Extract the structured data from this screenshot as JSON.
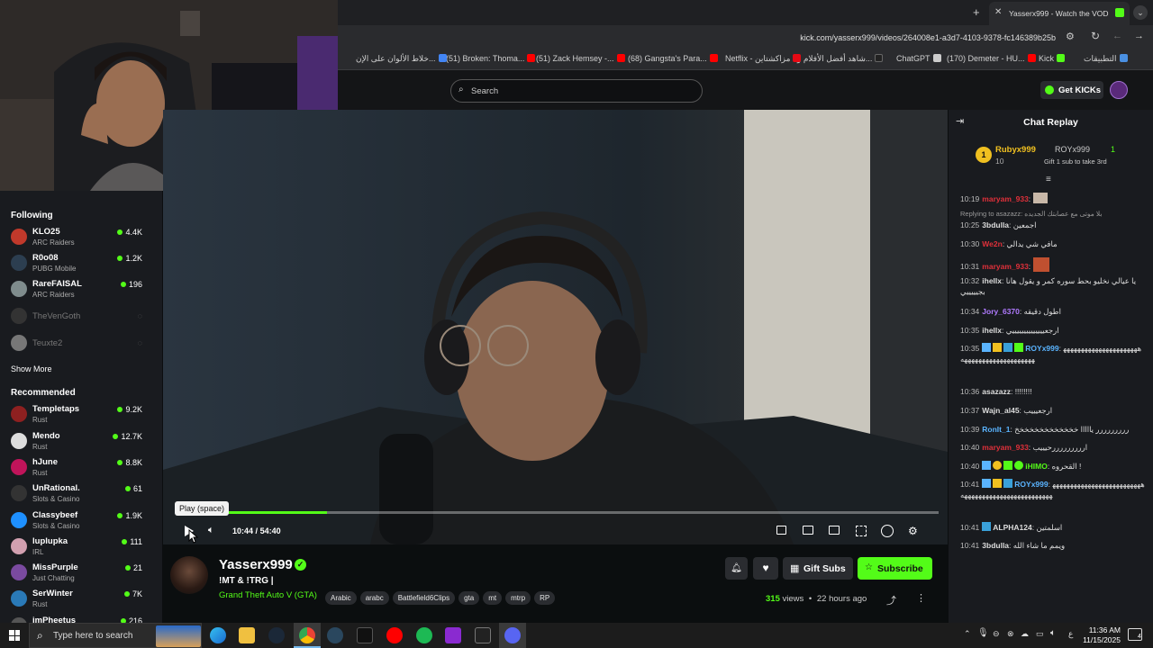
{
  "browser": {
    "active_tab_title": "Yasserx999 - Watch the VOD o",
    "url": "kick.com/yasserx999/videos/264008e1-a3d7-4103-9378-fc146389b25b",
    "bookmarks": [
      {
        "label": "التطبيقات",
        "color": "#4a90e2"
      },
      {
        "label": "Kick",
        "color": "#53fc18"
      },
      {
        "label": "(170) Demeter - HU...",
        "color": "#ff0000"
      },
      {
        "label": "ChatGPT",
        "color": "#ffffff"
      },
      {
        "label": "شاهد أفضل الأفلام و...",
        "color": "#222222"
      },
      {
        "label": "Netflix - مزاكشتاين",
        "color": "#e50914"
      },
      {
        "label": "(68) Gangsta's Para...",
        "color": "#ff0000"
      },
      {
        "label": "(51) Zack Hemsey -...",
        "color": "#ff0000"
      },
      {
        "label": "(51) Broken: Thoma...",
        "color": "#ff0000"
      },
      {
        "label": "خلاط الألوان على الإن...",
        "color": "#4285f4"
      }
    ]
  },
  "header": {
    "search_placeholder": "Search",
    "get_kicks_label": "Get KICKs",
    "brand_color": "#53fc18"
  },
  "sidebar": {
    "following_title": "Following",
    "following": [
      {
        "name": "KLO25",
        "category": "ARC Raiders",
        "viewers": "4.4K",
        "color": "#c0392b"
      },
      {
        "name": "R0o08",
        "category": "PUBG Mobile",
        "viewers": "1.2K",
        "color": "#2c3e50"
      },
      {
        "name": "RareFAISAL",
        "category": "ARC Raiders",
        "viewers": "196",
        "color": "#7f8c8d"
      },
      {
        "name": "TheVenGoth",
        "category": "",
        "viewers": "",
        "color": "#333333"
      },
      {
        "name": "Teuxte2",
        "category": "",
        "viewers": "",
        "color": "#666666"
      }
    ],
    "show_more_label": "Show More",
    "recommended_title": "Recommended",
    "recommended": [
      {
        "name": "Templetaps",
        "category": "Rust",
        "viewers": "9.2K",
        "color": "#8e2020"
      },
      {
        "name": "Mendo",
        "category": "Rust",
        "viewers": "12.7K",
        "color": "#dddddd"
      },
      {
        "name": "hJune",
        "category": "Rust",
        "viewers": "8.8K",
        "color": "#c0145a"
      },
      {
        "name": "UnRational.",
        "category": "Slots & Casino",
        "viewers": "61",
        "color": "#333333"
      },
      {
        "name": "Classybeef",
        "category": "Slots & Casino",
        "viewers": "1.9K",
        "color": "#1e90ff"
      },
      {
        "name": "luplupka",
        "category": "IRL",
        "viewers": "111",
        "color": "#d2a0b0"
      },
      {
        "name": "MissPurple",
        "category": "Just Chatting",
        "viewers": "21",
        "color": "#7a4aa0"
      },
      {
        "name": "SerWinter",
        "category": "Rust",
        "viewers": "7K",
        "color": "#2a7ab8"
      },
      {
        "name": "imPheetus",
        "category": "",
        "viewers": "216",
        "color": "#555555"
      }
    ]
  },
  "player": {
    "tooltip": "Play (space)",
    "time_current": "10:44",
    "time_separator": "/",
    "time_total": "54:40",
    "progress_fraction": 0.196
  },
  "stream": {
    "channel": "Yasserx999",
    "title": "!MT & !TRG |",
    "category": "Grand Theft Auto V (GTA)",
    "tags": [
      "Arabic",
      "arabc",
      "Battlefield6Clips",
      "gta",
      "mt",
      "mtrp",
      "RP"
    ],
    "views_count": "315",
    "views_label": "views",
    "dot": "•",
    "age": "22 hours ago",
    "gift_subs_label": "Gift Subs",
    "subscribe_label": "Subscribe"
  },
  "chat": {
    "title": "Chat Replay",
    "leaderboard": {
      "rank": "1",
      "user": "Rubyx999",
      "count": "10",
      "second_user": "ROYx999",
      "second_count": "1",
      "gift_hint": "Gift 1 sub to take 3rd"
    },
    "messages": [
      {
        "time": "10:19",
        "user": "maryam_933",
        "color": "#e0303a",
        "text": ""
      },
      {
        "time": "",
        "user": "",
        "color": "#999999",
        "text": "Replying to asazazz: بلا موتى مع عصابتك الجديده"
      },
      {
        "time": "10:25",
        "user": "3bdulla",
        "color": "#dddddd",
        "text": "اجمعين"
      },
      {
        "time": "10:30",
        "user": "We2n",
        "color": "#e0303a",
        "text": "مافي شي يدالي"
      },
      {
        "time": "10:31",
        "user": "maryam_933",
        "color": "#e0303a",
        "text": ""
      },
      {
        "time": "10:32",
        "user": "ihellx",
        "color": "#dddddd",
        "text": "يا عيالي نخليو بحط سوره كمر و يقول هانا بجيييييي"
      },
      {
        "time": "10:34",
        "user": "Jory_6370",
        "color": "#b07aff",
        "text": "اطول دقيقه"
      },
      {
        "time": "10:35",
        "user": "ihellx",
        "color": "#dddddd",
        "text": "ارجعييييييييييييييي"
      },
      {
        "time": "10:35",
        "user": "ROYx999",
        "color": "#5ab4ff",
        "text": "ههههههههههههههههههههههههههههههههههههههههههه"
      },
      {
        "time": "10:36",
        "user": "asazazz",
        "color": "#dddddd",
        "text": "!!!!!!!!"
      },
      {
        "time": "10:37",
        "user": "Wajn_al45",
        "color": "#dddddd",
        "text": "ارجعيييب"
      },
      {
        "time": "10:39",
        "user": "RonIt_1",
        "color": "#5ab4ff",
        "text": "ررررررررر يااااا خخخخخخخخخخخخخ"
      },
      {
        "time": "10:40",
        "user": "maryam_933",
        "color": "#e0303a",
        "text": "ارررررررررحيييب"
      },
      {
        "time": "10:40",
        "user": "iHIMO",
        "color": "#53fc18",
        "text": "القحروه !"
      },
      {
        "time": "10:41",
        "user": "ROYx999",
        "color": "#5ab4ff",
        "text": "هههههههههههههههههههههههههههههههههههههههههههههههههههه"
      },
      {
        "time": "10:41",
        "user": "ALPHA124",
        "color": "#dddddd",
        "text": "اسلمتين"
      },
      {
        "time": "10:41",
        "user": "3bdulla",
        "color": "#dddddd",
        "text": "ويمم ما شاء الله"
      }
    ]
  },
  "taskbar": {
    "search_placeholder": "Type here to search",
    "time": "11:36 AM",
    "date": "11/15/2025",
    "lang": "ع",
    "notification_count": "4"
  }
}
